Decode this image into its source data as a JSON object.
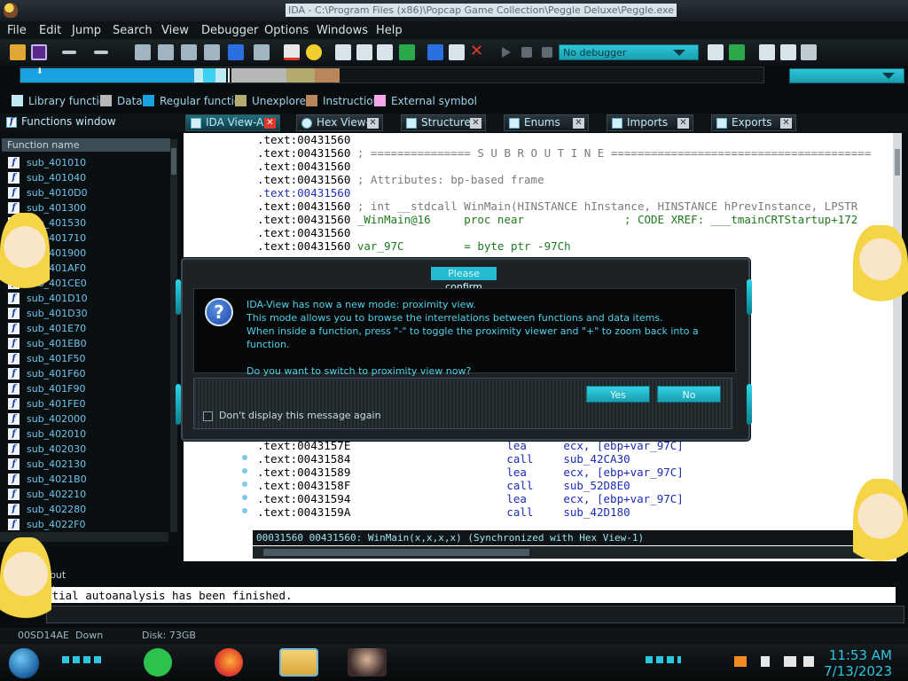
{
  "window": {
    "title": "IDA - C:\\Program Files (x86)\\Popcap Game Collection\\Peggle Deluxe\\Peggle.exe"
  },
  "menu": [
    "File",
    "Edit",
    "Jump",
    "Search",
    "View",
    "Debugger",
    "Options",
    "Windows",
    "Help"
  ],
  "toolbar": {
    "debugger_select": "No debugger"
  },
  "legend": [
    {
      "label": "Library function",
      "color": "#bfeaf4"
    },
    {
      "label": "Data",
      "color": "#b7b7b7"
    },
    {
      "label": "Regular function",
      "color": "#1aa2e0"
    },
    {
      "label": "Unexplored",
      "color": "#b3ab6e"
    },
    {
      "label": "Instruction",
      "color": "#b8865a"
    },
    {
      "label": "External symbol",
      "color": "#f5a6e8"
    }
  ],
  "tabs": {
    "functions": "Functions window",
    "ida_view": "IDA View-A",
    "hex_view": "Hex View-1",
    "structures": "Structures",
    "enums": "Enums",
    "imports": "Imports",
    "exports": "Exports"
  },
  "functions_window": {
    "header": "Function name",
    "items": [
      "sub_401010",
      "sub_401040",
      "sub_4010D0",
      "sub_401300",
      "sub_401530",
      "sub_401710",
      "sub_401900",
      "sub_401AF0",
      "sub_401CE0",
      "sub_401D10",
      "sub_401D30",
      "sub_401E70",
      "sub_401EB0",
      "sub_401F50",
      "sub_401F60",
      "sub_401F90",
      "sub_401FE0",
      "sub_402000",
      "sub_402010",
      "sub_402030",
      "sub_402130",
      "sub_4021B0",
      "sub_402210",
      "sub_402280",
      "sub_4022F0"
    ]
  },
  "code": {
    "top_lines": [
      {
        "addr": ".text:00431560",
        "rest": ""
      },
      {
        "addr": ".text:00431560",
        "rest": " ; =============== S U B R O U T I N E ======================================="
      },
      {
        "addr": ".text:00431560",
        "rest": ""
      },
      {
        "addr": ".text:00431560",
        "rest": " ; Attributes: bp-based frame"
      },
      {
        "addr": ".text:00431560",
        "rest": ""
      },
      {
        "addr": ".text:00431560",
        "rest": " ; int __stdcall WinMain(HINSTANCE hInstance, HINSTANCE hPrevInstance, LPSTR"
      },
      {
        "addr": ".text:00431560",
        "rest": " _WinMain@16     proc near               ; CODE XREF: ___tmainCRTStartup+172"
      },
      {
        "addr": ".text:00431560",
        "rest": ""
      },
      {
        "addr": ".text:00431560",
        "rest": " var_97C         = byte ptr -97Ch"
      }
    ],
    "bottom_lines": [
      {
        "addr": ".text:0043157E",
        "op": "lea",
        "arg": "ecx, [ebp+var_97C]"
      },
      {
        "addr": ".text:00431584",
        "op": "call",
        "arg": "sub_42CA30"
      },
      {
        "addr": ".text:00431589",
        "op": "lea",
        "arg": "ecx, [ebp+var_97C]"
      },
      {
        "addr": ".text:0043158F",
        "op": "call",
        "arg": "sub_52D8E0"
      },
      {
        "addr": ".text:00431594",
        "op": "lea",
        "arg": "ecx, [ebp+var_97C]"
      },
      {
        "addr": ".text:0043159A",
        "op": "call",
        "arg": "sub_42D180"
      }
    ],
    "status": "00031560 00431560: WinMain(x,x,x,x) (Synchronized with Hex View-1)"
  },
  "dialog": {
    "title": "Please confirm",
    "message": [
      "IDA-View has now a new mode: proximity view.",
      "This mode allows you to browse the interrelations between functions and data items.",
      "When inside a function, press \"-\" to toggle the proximity viewer and \"+\" to zoom back into a function.",
      "",
      "Do you want to switch to proximity view now?"
    ],
    "yes": "Yes",
    "no": "No",
    "checkbox_label": "Don't display this message again"
  },
  "output": {
    "header": "Output window",
    "line": "initial autoanalysis has been finished."
  },
  "statusbar": {
    "address": "00SD14AE",
    "state": "Down",
    "disk": "Disk: 73GB"
  },
  "taskbar": {
    "time": "11:53 AM",
    "date": "7/13/2023"
  }
}
